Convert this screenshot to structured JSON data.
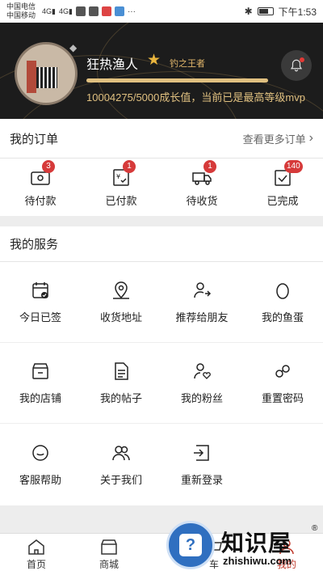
{
  "status_bar": {
    "carrier1": "中国电信",
    "carrier2": "中国移动",
    "time": "下午1:53"
  },
  "profile": {
    "username": "狂热渔人",
    "level_title": "钓之王者",
    "growth_text": "10004275/5000成长值，当前已是最高等级mvp",
    "progress_fraction": 1.0,
    "accent_color": "#e0c080"
  },
  "orders": {
    "title": "我的订单",
    "more_label": "查看更多订单",
    "items": [
      {
        "label": "待付款",
        "badge": "3",
        "icon": "wallet-icon"
      },
      {
        "label": "已付款",
        "badge": "1",
        "icon": "paid-receipt-icon"
      },
      {
        "label": "待收货",
        "badge": "1",
        "icon": "delivery-truck-icon"
      },
      {
        "label": "已完成",
        "badge": "140",
        "icon": "completed-check-icon"
      }
    ]
  },
  "services": {
    "title": "我的服务",
    "items": [
      {
        "label": "今日已签",
        "icon": "calendar-check-icon"
      },
      {
        "label": "收货地址",
        "icon": "map-pin-icon"
      },
      {
        "label": "推荐给朋友",
        "icon": "share-user-icon"
      },
      {
        "label": "我的鱼蛋",
        "icon": "egg-icon"
      },
      {
        "label": "我的店铺",
        "icon": "shop-icon"
      },
      {
        "label": "我的帖子",
        "icon": "document-icon"
      },
      {
        "label": "我的粉丝",
        "icon": "fans-heart-icon"
      },
      {
        "label": "重置密码",
        "icon": "key-reset-icon"
      },
      {
        "label": "客服帮助",
        "icon": "customer-service-icon"
      },
      {
        "label": "关于我们",
        "icon": "people-group-icon"
      },
      {
        "label": "重新登录",
        "icon": "login-icon"
      }
    ]
  },
  "tabbar": {
    "items": [
      {
        "label": "首页",
        "icon": "home-icon"
      },
      {
        "label": "商城",
        "icon": "store-icon"
      },
      {
        "label": "车",
        "icon": "cart-icon"
      },
      {
        "label": "我的",
        "icon": "profile-icon"
      }
    ]
  },
  "watermark": {
    "title": "知识屋",
    "domain": "zhishiwu.com"
  }
}
